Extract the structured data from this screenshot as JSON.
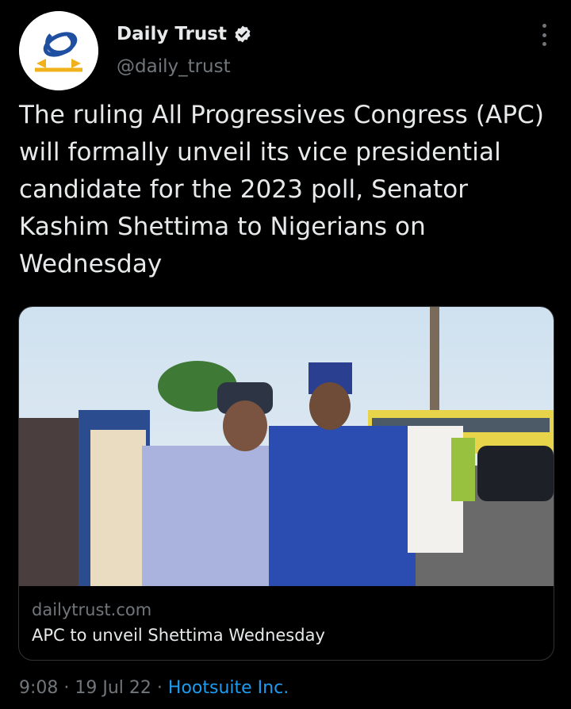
{
  "author": {
    "display_name": "Daily Trust",
    "handle": "@daily_trust"
  },
  "tweet": {
    "text": "The ruling All Progressives Congress (APC) will formally unveil its vice presidential candidate for the 2023 poll, Senator Kashim Shettima to Nigerians on Wednesday"
  },
  "card": {
    "domain": "dailytrust.com",
    "title": "APC to unveil Shettima Wednesday"
  },
  "meta": {
    "time": "9:08",
    "separator": " · ",
    "date": "19 Jul 22",
    "source": "Hootsuite Inc."
  },
  "colors": {
    "background": "#000000",
    "text": "#e7e9ea",
    "muted": "#71767b",
    "link": "#1d9bf0"
  },
  "icons": {
    "avatar": "daily-trust-logo",
    "verified": "verified-badge-icon",
    "more": "more-options-icon"
  }
}
